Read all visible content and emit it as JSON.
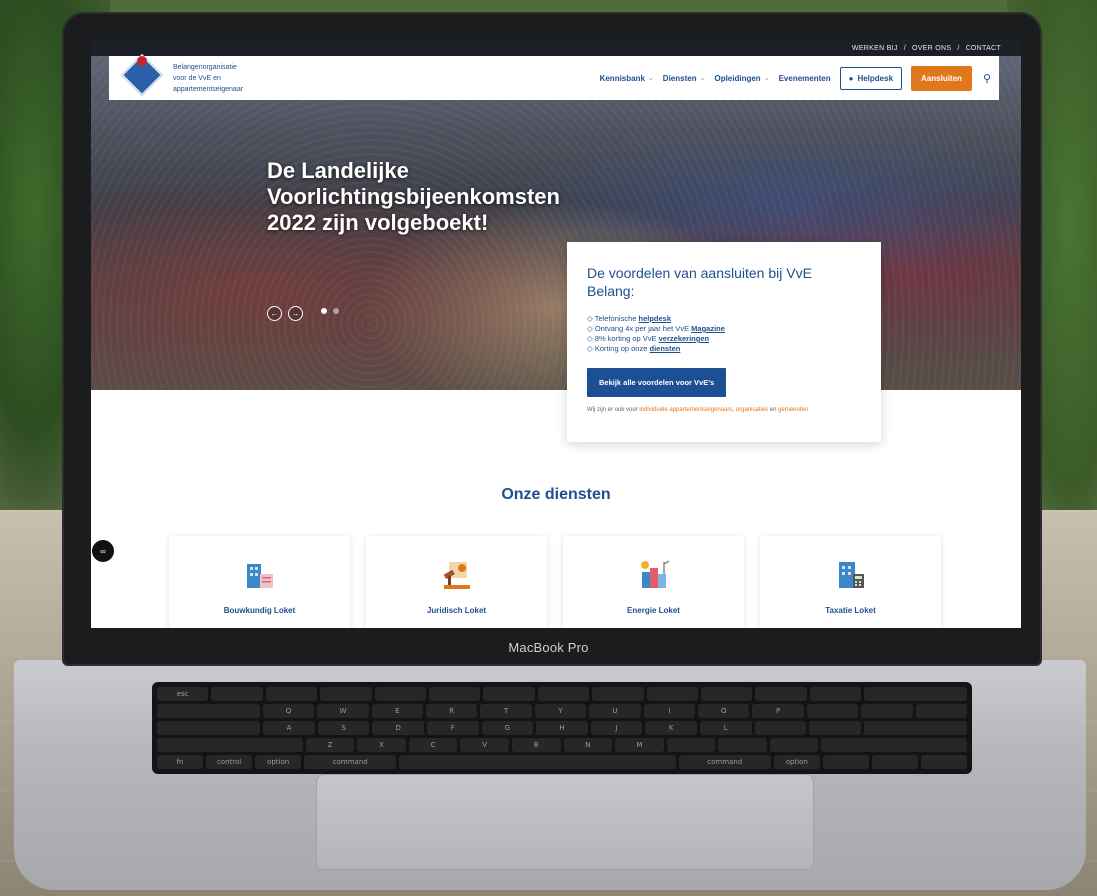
{
  "topbar": {
    "links": [
      "WERKEN BIJ",
      "/",
      "OVER ONS",
      "/",
      "CONTACT"
    ]
  },
  "header": {
    "tagline": [
      "Belangenorganisatie",
      "voor de VvE en",
      "appartementseigenaar"
    ],
    "nav": [
      {
        "label": "Kennisbank",
        "dropdown": true
      },
      {
        "label": "Diensten",
        "dropdown": true
      },
      {
        "label": "Opleidingen",
        "dropdown": true
      },
      {
        "label": "Evenementen",
        "dropdown": false
      }
    ],
    "helpdesk_label": "Helpdesk",
    "join_label": "Aansluiten",
    "accent_color": "#1f4f8f",
    "orange_color": "#e1771b"
  },
  "hero": {
    "title": "De Landelijke Voorlichtingsbijeenkomsten 2022 zijn volgeboekt!",
    "slides_total": 2,
    "active_slide": 1
  },
  "card": {
    "title": "De voordelen van aansluiten bij VvE Belang:",
    "benefits": [
      {
        "prefix": "◇ Telefonische ",
        "link": "helpdesk"
      },
      {
        "prefix": "◇ Ontvang 4x per jaar het VvE ",
        "link": "Magazine"
      },
      {
        "prefix": "◇ 8% korting op VvE ",
        "link": "verzekeringen"
      },
      {
        "prefix": "◇ Korting op onze ",
        "link": "diensten"
      }
    ],
    "button_label": "Bekijk alle voordelen voor VvE's",
    "footer_prefix": "Wij zijn er ook voor ",
    "footer_link1": "individuele appartementseigenaars",
    "footer_sep1": ", ",
    "footer_link2": "organisaties",
    "footer_sep2": " en ",
    "footer_link3": "gemeenten"
  },
  "services": {
    "title": "Onze diensten",
    "items": [
      {
        "label": "Bouwkundig Loket",
        "icon": "building-plan-icon"
      },
      {
        "label": "Juridisch Loket",
        "icon": "gavel-icon"
      },
      {
        "label": "Energie Loket",
        "icon": "energy-city-icon"
      },
      {
        "label": "Taxatie Loket",
        "icon": "building-calculator-icon"
      }
    ]
  },
  "laptop": {
    "brand": "MacBook Pro"
  }
}
